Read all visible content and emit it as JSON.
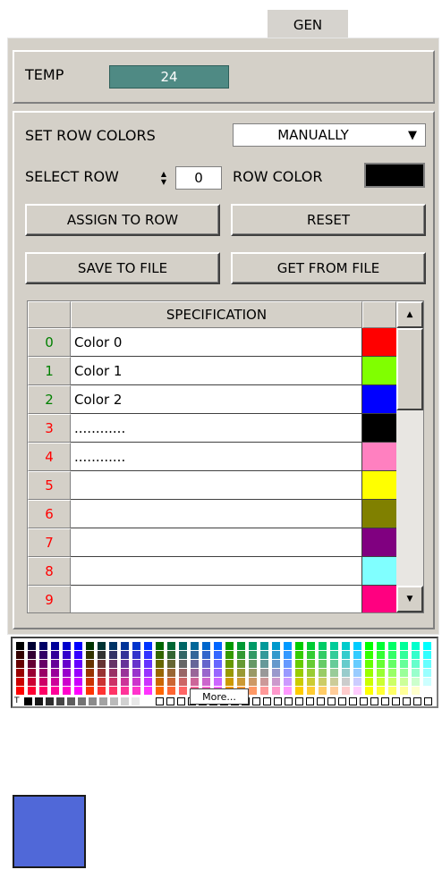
{
  "tab": {
    "label": "GEN"
  },
  "temp": {
    "label": "TEMP",
    "value": "24"
  },
  "row_colors": {
    "label": "SET ROW COLORS",
    "mode": "MANUALLY"
  },
  "select_row": {
    "label": "SELECT ROW",
    "value": "0"
  },
  "row_color": {
    "label": "ROW COLOR",
    "color": "#000000"
  },
  "buttons": {
    "assign": "ASSIGN TO ROW",
    "reset": "RESET",
    "save": "SAVE TO FILE",
    "get": "GET FROM FILE"
  },
  "table": {
    "header": "SPECIFICATION",
    "rows": [
      {
        "index": "0",
        "spec": "Color 0",
        "color": "#ff0000",
        "index_color": "#008000"
      },
      {
        "index": "1",
        "spec": "Color 1",
        "color": "#80ff00",
        "index_color": "#008000"
      },
      {
        "index": "2",
        "spec": "Color 2",
        "color": "#0000ff",
        "index_color": "#008000"
      },
      {
        "index": "3",
        "spec": "............",
        "color": "#000000",
        "index_color": "#ff0000"
      },
      {
        "index": "4",
        "spec": "............",
        "color": "#ff80c0",
        "index_color": "#ff0000"
      },
      {
        "index": "5",
        "spec": "",
        "color": "#ffff00",
        "index_color": "#ff0000"
      },
      {
        "index": "6",
        "spec": "",
        "color": "#808000",
        "index_color": "#ff0000"
      },
      {
        "index": "7",
        "spec": "",
        "color": "#800080",
        "index_color": "#ff0000"
      },
      {
        "index": "8",
        "spec": "",
        "color": "#80ffff",
        "index_color": "#ff0000"
      },
      {
        "index": "9",
        "spec": "",
        "color": "#ff0080",
        "index_color": "#ff0000"
      }
    ]
  },
  "palette": {
    "transparent_label": "T",
    "more_label": "More..."
  },
  "selected_color": "#5068d8"
}
